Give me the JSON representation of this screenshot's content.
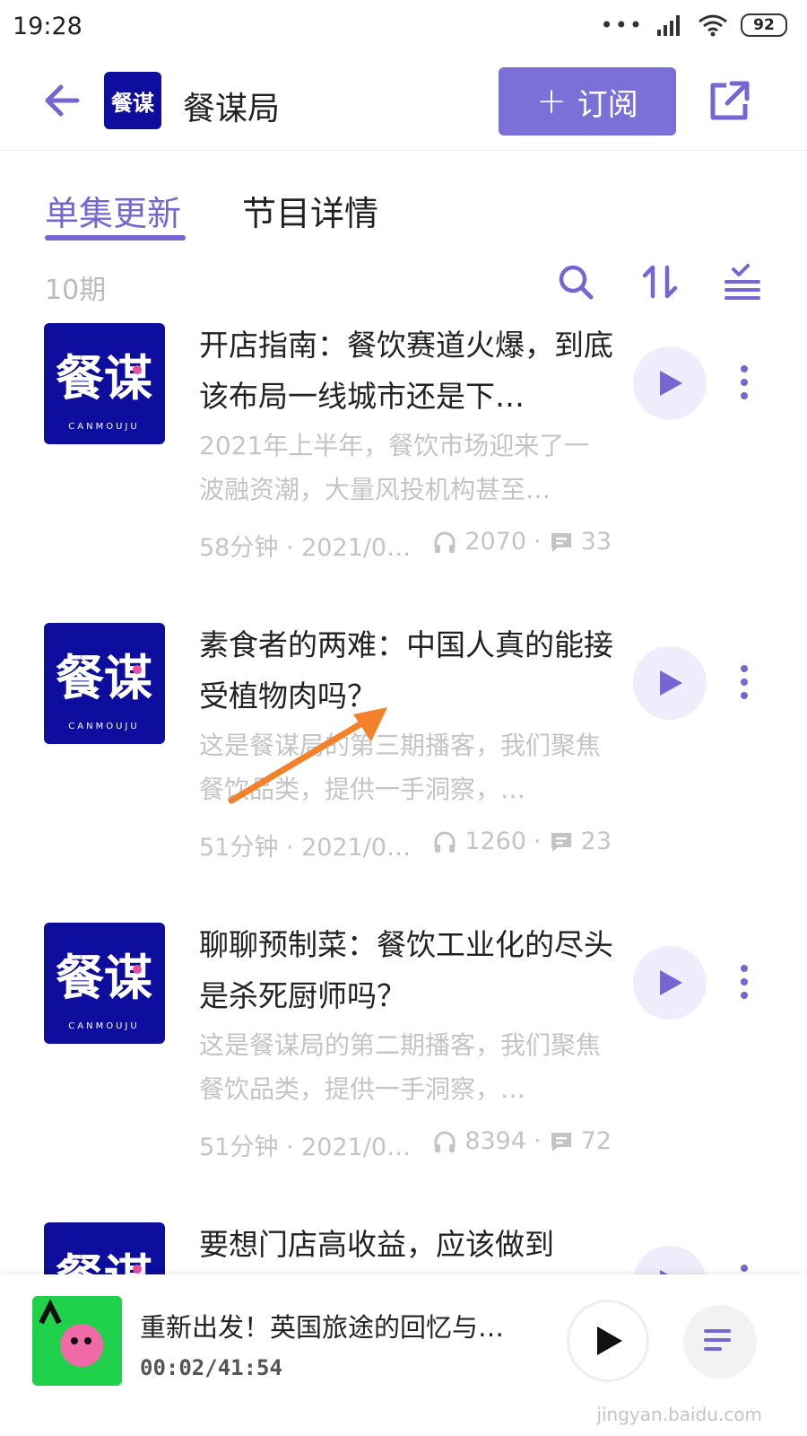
{
  "status_bar": {
    "time": "19:28",
    "battery": "92"
  },
  "header": {
    "channel_title": "餐谋局",
    "subscribe_label": "订阅",
    "logo_text": "餐谋"
  },
  "tabs": [
    {
      "label": "单集更新",
      "active": true
    },
    {
      "label": "节目详情",
      "active": false
    }
  ],
  "toolbar": {
    "count": "10期"
  },
  "episodes": [
    {
      "title": "开店指南：餐饮赛道火爆，到底该布局一线城市还是下…",
      "description": "2021年上半年，餐饮市场迎来了一波融资潮，大量风投机构甚至…",
      "duration_date": "58分钟 · 2021/0…",
      "plays": "2070",
      "comments": "33"
    },
    {
      "title": "素食者的两难：中国人真的能接受植物肉吗？",
      "description": "这是餐谋局的第三期播客，我们聚焦餐饮品类，提供一手洞察，…",
      "duration_date": "51分钟 · 2021/0…",
      "plays": "1260",
      "comments": "23"
    },
    {
      "title": "聊聊预制菜：餐饮工业化的尽头是杀死厨师吗？",
      "description": "这是餐谋局的第二期播客，我们聚焦餐饮品类，提供一手洞察，…",
      "duration_date": "51分钟 · 2021/0…",
      "plays": "8394",
      "comments": "72"
    },
    {
      "title": "要想门店高收益，应该做到",
      "description": "",
      "duration_date": "",
      "plays": "",
      "comments": ""
    }
  ],
  "cover_art": {
    "main": "餐谋",
    "sub": "CANMOUJU"
  },
  "player": {
    "title": "重新出发！英国旅途的回忆与…",
    "time": "00:02/41:54"
  },
  "watermark": "jingyan.baidu.com",
  "colors": {
    "accent": "#7566d2",
    "cover_bg": "#0d0d9e",
    "arrow": "#f5802a"
  }
}
